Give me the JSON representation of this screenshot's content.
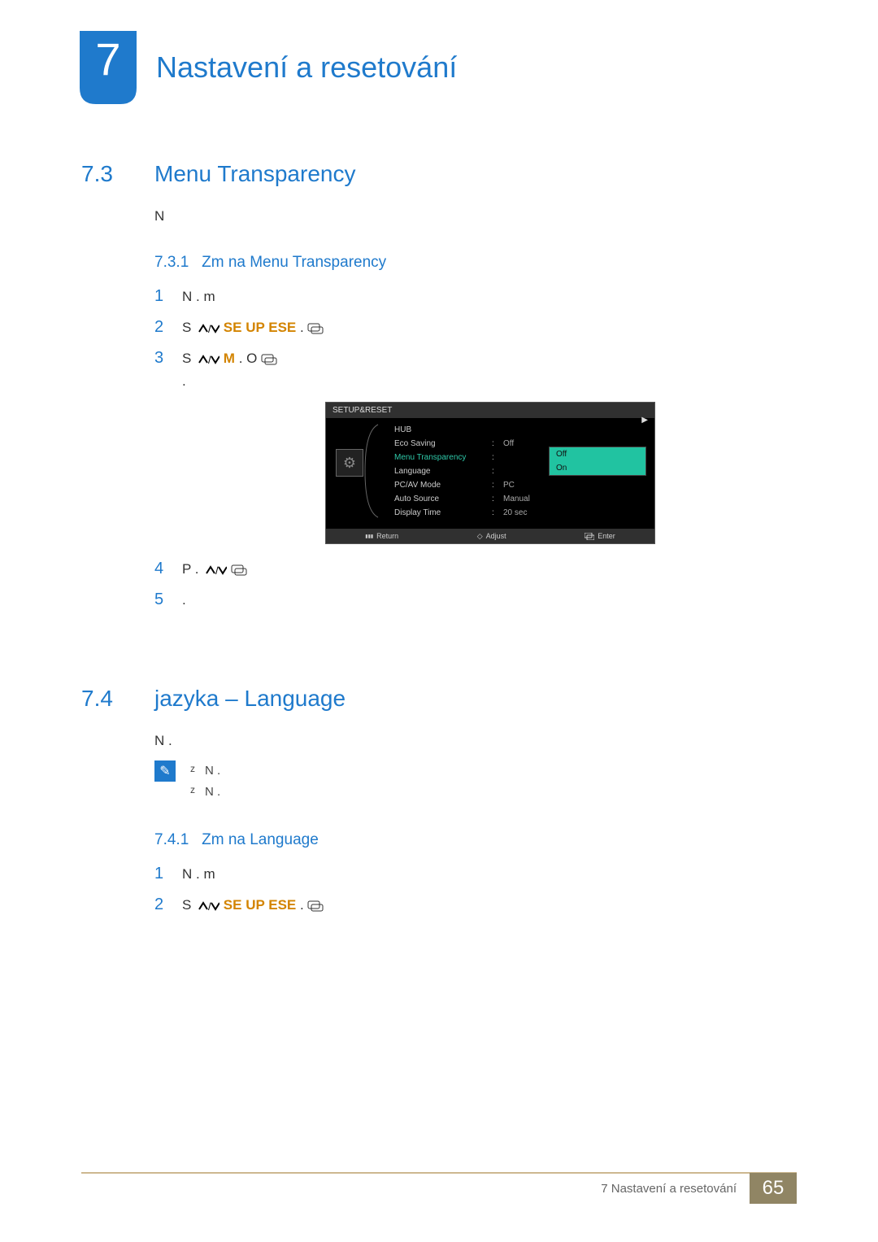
{
  "header": {
    "chapter_number": "7",
    "chapter_title": "Nastavení a resetování"
  },
  "section1": {
    "num": "7.3",
    "title": "Menu Transparency",
    "intro": "N",
    "subsection": {
      "num": "7.3.1",
      "title": "Zm na Menu Transparency"
    },
    "step1_text": "N     .                              m",
    "step2_prefix": "S             ",
    "step2_mid": "                               ",
    "step2_hl": "SE UP  ESE",
    "step2_suffix": "             .      ",
    "step3_prefix": "S             ",
    "step3_mid": "                               ",
    "step3_hl": "M",
    "step3_suffix": "                                    . O     ",
    "step3_line2": ".",
    "step4_prefix": "P               .  ",
    "step4_suffix": "                                                                    ",
    "step5_text": "   ."
  },
  "osd": {
    "title": "SETUP&RESET",
    "rows": {
      "hub": "HUB",
      "eco": "Eco Saving",
      "eco_val": "Off",
      "menu_transparency": "Menu Transparency",
      "language": "Language",
      "pcav": "PC/AV Mode",
      "pcav_val": "PC",
      "auto_source": "Auto Source",
      "auto_source_val": "Manual",
      "display_time": "Display Time",
      "display_time_val": "20 sec"
    },
    "dropdown": {
      "off": "Off",
      "on": "On"
    },
    "footer": {
      "return": "Return",
      "adjust": "Adjust",
      "enter": "Enter"
    }
  },
  "section2": {
    "num": "7.4",
    "title": "jazyka – Language",
    "intro": "N  .",
    "bullet1": "N      .",
    "bullet2": "N    .",
    "subsection": {
      "num": "7.4.1",
      "title": "Zm na Language"
    },
    "step1_text": "N     .                              m",
    "step2_prefix": "S             ",
    "step2_mid": "                               ",
    "step2_hl": "SE UP  ESE",
    "step2_suffix": "             .      "
  },
  "footer": {
    "label": "7 Nastavení a resetování",
    "page": "65"
  }
}
